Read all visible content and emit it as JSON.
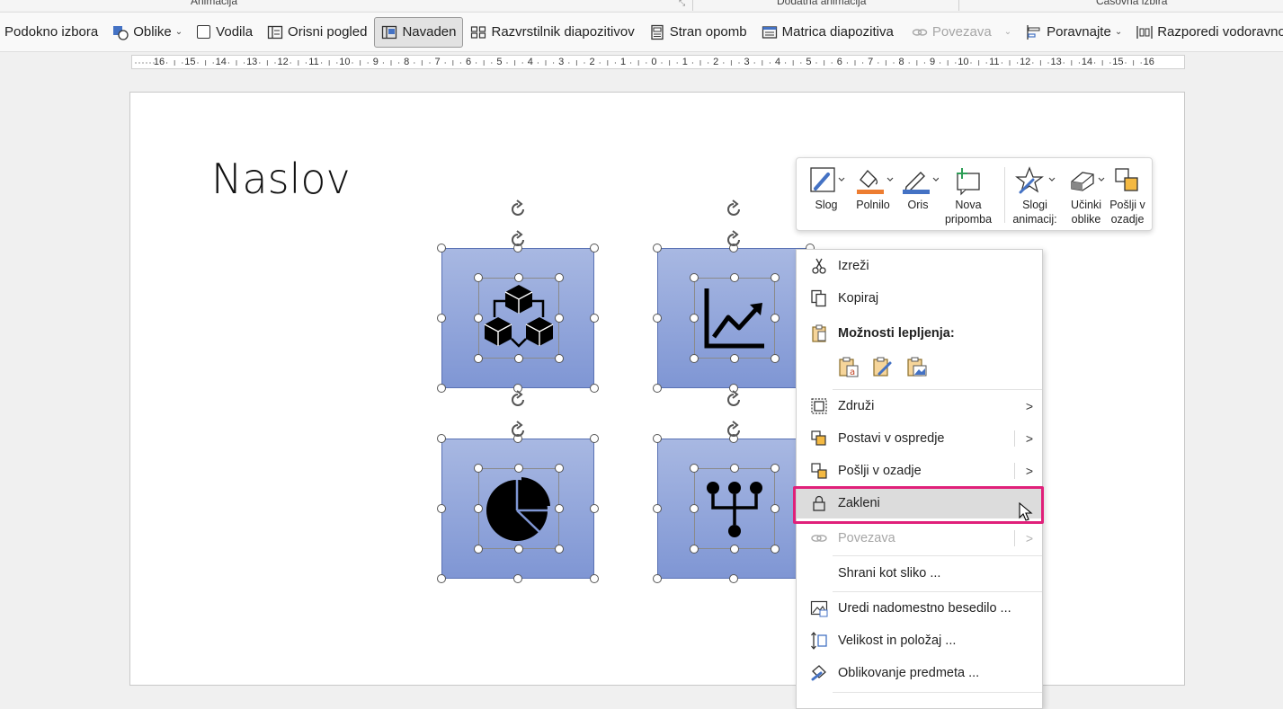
{
  "group_labels": [
    "Animacija",
    "Dodatna animacija",
    "Časovna izbira"
  ],
  "ribbon": {
    "items": [
      {
        "label": "Podokno izbora"
      },
      {
        "label": "Oblike",
        "icon": "shapes-icon"
      },
      {
        "label": "Vodila",
        "icon": "checkbox-icon"
      },
      {
        "label": "Orisni pogled",
        "icon": "outline-view-icon"
      },
      {
        "label": "Navaden",
        "icon": "normal-view-icon",
        "active": true
      },
      {
        "label": "Razvrstilnik diapozitivov",
        "icon": "slide-sorter-icon"
      },
      {
        "label": "Stran opomb",
        "icon": "notes-page-icon"
      },
      {
        "label": "Matrica diapozitiva",
        "icon": "slide-master-icon"
      },
      {
        "label": "Povezava",
        "icon": "link-icon",
        "disabled": true
      },
      {
        "label": "Poravnajte",
        "icon": "align-icon"
      },
      {
        "label": "Razporedi vodoravno",
        "icon": "distribute-icon"
      }
    ]
  },
  "ruler": {
    "labels": [
      "16",
      "15",
      "14",
      "13",
      "12",
      "11",
      "10",
      "9",
      "8",
      "7",
      "6",
      "5",
      "4",
      "3",
      "2",
      "1",
      "0",
      "1",
      "2",
      "3",
      "4",
      "5",
      "6",
      "7",
      "8",
      "9",
      "10",
      "11",
      "12",
      "13",
      "14",
      "15",
      "16"
    ]
  },
  "slide": {
    "title": "Naslov"
  },
  "mini_toolbar": {
    "slog": "Slog",
    "polnilo": "Polnilo",
    "oris": "Oris",
    "nova_pripomba_1": "Nova",
    "nova_pripomba_2": "pripomba",
    "slogi_animacij_1": "Slogi",
    "slogi_animacij_2": "animacij:",
    "ucinki_oblike_1": "Učinki",
    "ucinki_oblike_2": "oblike",
    "poslji_v_ozadje_1": "Pošlji v",
    "poslji_v_ozadje_2": "ozadje",
    "fill_color": "#ed7d31",
    "outline_color": "#4472c4"
  },
  "context_menu": {
    "cut": "Izreži",
    "copy": "Kopiraj",
    "paste_options": "Možnosti lepljenja:",
    "group": "Združi",
    "bring_front": "Postavi v ospredje",
    "send_back": "Pošlji v ozadje",
    "lock": "Zakleni",
    "link": "Povezava",
    "save_as_picture": "Shrani kot sliko ...",
    "alt_text": "Uredi nadomestno besedilo ...",
    "size_position": "Velikost in položaj ...",
    "format_object": "Oblikovanje predmeta ..."
  },
  "colors": {
    "highlight": "#e0207a",
    "shape_fill_top": "#a8b8e2",
    "shape_fill_bottom": "#7f96d4"
  }
}
